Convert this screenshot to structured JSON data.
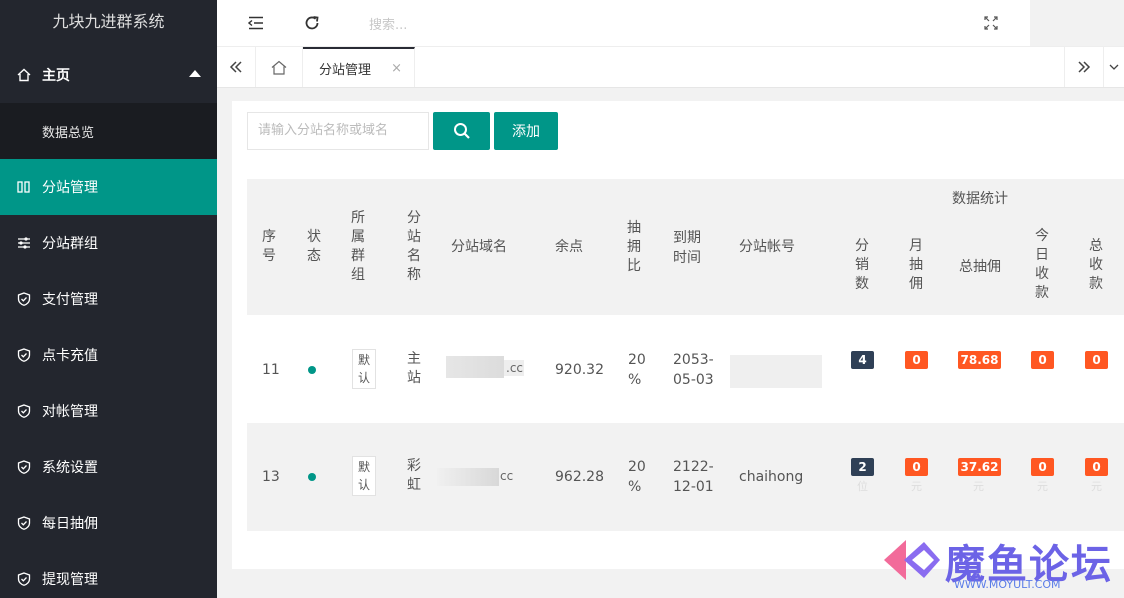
{
  "app": {
    "title": "九块九进群系统"
  },
  "sidebar": {
    "home": "主页",
    "overview": "数据总览",
    "items": [
      {
        "label": "分站管理",
        "icon": "columns-icon"
      },
      {
        "label": "分站群组",
        "icon": "sliders-icon"
      },
      {
        "label": "支付管理",
        "icon": "shield-icon"
      },
      {
        "label": "点卡充值",
        "icon": "shield-icon"
      },
      {
        "label": "对帐管理",
        "icon": "shield-icon"
      },
      {
        "label": "系统设置",
        "icon": "shield-icon"
      },
      {
        "label": "每日抽佣",
        "icon": "shield-icon"
      },
      {
        "label": "提现管理",
        "icon": "shield-icon"
      }
    ]
  },
  "header": {
    "search_placeholder": "搜索..."
  },
  "tabs": {
    "active": "分站管理",
    "close": "×"
  },
  "toolbar": {
    "search_placeholder": "请输入分站名称或域名",
    "add_label": "添加"
  },
  "table": {
    "headers": {
      "seq": "序号",
      "status": "状态",
      "group": "所属群组",
      "name": "分站名称",
      "domain": "分站域名",
      "balance": "余点",
      "ratio": "抽拥比",
      "expire": "到期时间",
      "account": "分站帐号",
      "stats": "数据统计",
      "sales": "分销数",
      "monthly": "月抽佣",
      "total_commission": "总抽佣",
      "today_income": "今日收款",
      "total_income": "总收款"
    },
    "rows": [
      {
        "seq": "11",
        "group": "默认",
        "name": "主站",
        "domain_suffix": ".cc",
        "balance": "920.32",
        "ratio_num": "20",
        "ratio_pct": "%",
        "expire_a": "2053-",
        "expire_b": "05-03",
        "account": "",
        "sales": "4",
        "monthly": "0",
        "total_commission": "78.68",
        "today_income": "0",
        "total_income": "0"
      },
      {
        "seq": "13",
        "group": "默认",
        "name": "彩虹",
        "domain_suffix": "cc",
        "balance": "962.28",
        "ratio_num": "20",
        "ratio_pct": "%",
        "expire_a": "2122-",
        "expire_b": "12-01",
        "account": "chaihong",
        "sales": "2",
        "sales_unit": "位",
        "monthly": "0",
        "monthly_unit": "元",
        "total_commission": "37.62",
        "total_commission_unit": "元",
        "today_income": "0",
        "today_income_unit": "元",
        "total_income": "0",
        "total_income_unit": "元"
      }
    ]
  },
  "watermark": {
    "title": "魔鱼论坛",
    "url": "WWW.MOYULT.COM"
  },
  "colors": {
    "accent": "#009688",
    "sidebar": "#23262e",
    "badge_dark": "#2f4056",
    "badge_orange": "#ff5722"
  }
}
